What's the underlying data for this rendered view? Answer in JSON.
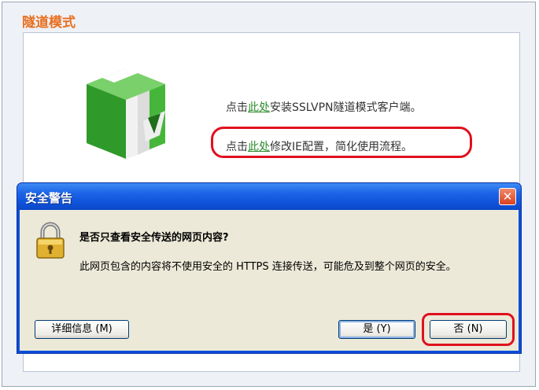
{
  "page": {
    "section_title": "隧道模式"
  },
  "panel": {
    "line1_prefix": "点击",
    "line1_link": "此处",
    "line1_suffix": "安装SSLVPN隧道模式客户端。",
    "line2_prefix": "点击",
    "line2_link": "此处",
    "line2_suffix": "修改IE配置，简化使用流程。"
  },
  "dialog": {
    "title": "安全警告",
    "close_glyph": "✕",
    "question": "是否只查看安全传送的网页内容?",
    "message": "此网页包含的内容将不使用安全的 HTTPS 连接传送，可能危及到整个网页的安全。",
    "buttons": {
      "details": "详细信息 (M)",
      "yes": "是 (Y)",
      "no": "否 (N)"
    }
  },
  "colors": {
    "title_orange": "#e96f1f",
    "link_green": "#2a8a2a",
    "highlight_red": "#e0101e",
    "titlebar_blue": "#0a4fd8"
  },
  "icons": [
    "green-box-download-icon",
    "padlock-icon",
    "close-icon"
  ]
}
